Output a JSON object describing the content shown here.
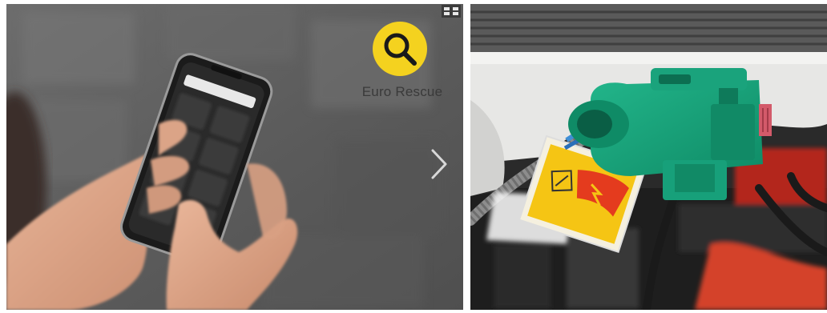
{
  "left_photo": {
    "brand": {
      "name": "Euro Rescue",
      "logo_color": "#f4d21f",
      "icon": "magnifier-icon"
    },
    "controls": {
      "next_icon": "chevron-right-icon",
      "expand_icon": "expand-icon"
    }
  },
  "right_photo": {
    "connector_color": "#14a27a",
    "label_colors": [
      "#f5c514",
      "#e43b1e"
    ]
  }
}
